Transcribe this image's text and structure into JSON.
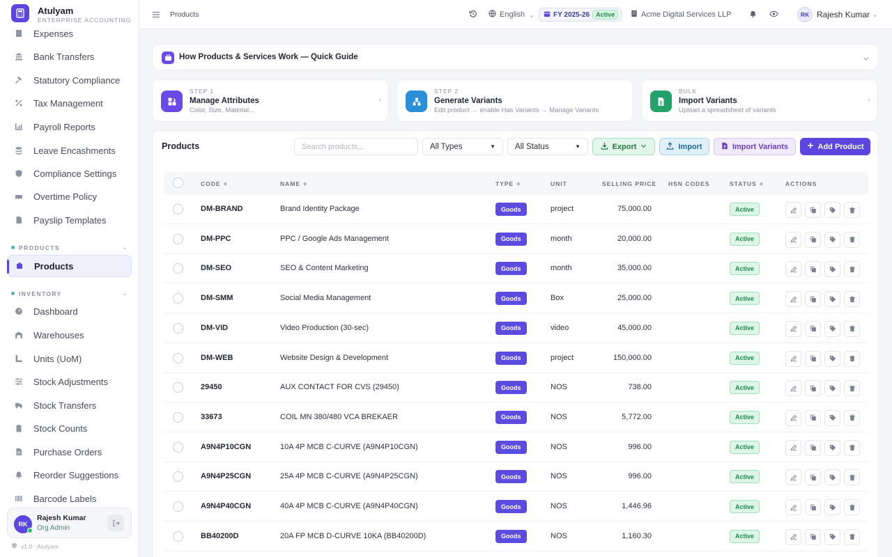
{
  "brand": {
    "name": "Atulyam",
    "subtitle": "ENTERPRISE ACCOUNTING"
  },
  "sidebar": {
    "items_top": [
      {
        "label": "Expenses",
        "icon": "receipt-icon"
      },
      {
        "label": "Bank Transfers",
        "icon": "bank-icon"
      },
      {
        "label": "Statutory Compliance",
        "icon": "gavel-icon"
      },
      {
        "label": "Tax Management",
        "icon": "percent-icon"
      },
      {
        "label": "Payroll Reports",
        "icon": "chart-icon"
      },
      {
        "label": "Leave Encashments",
        "icon": "coins-icon"
      },
      {
        "label": "Compliance Settings",
        "icon": "shield-icon"
      },
      {
        "label": "Overtime Policy",
        "icon": "clock-icon"
      },
      {
        "label": "Payslip Templates",
        "icon": "file-icon"
      }
    ],
    "section_products": "PRODUCTS",
    "products_item": "Products",
    "section_inventory": "INVENTORY",
    "items_inventory": [
      {
        "label": "Dashboard",
        "icon": "dashboard-icon"
      },
      {
        "label": "Warehouses",
        "icon": "warehouse-icon"
      },
      {
        "label": "Units (UoM)",
        "icon": "ruler-icon"
      },
      {
        "label": "Stock Adjustments",
        "icon": "sliders-icon"
      },
      {
        "label": "Stock Transfers",
        "icon": "truck-icon"
      },
      {
        "label": "Stock Counts",
        "icon": "clipboard-icon"
      },
      {
        "label": "Purchase Orders",
        "icon": "document-icon"
      },
      {
        "label": "Reorder Suggestions",
        "icon": "bell-icon"
      },
      {
        "label": "Barcode Labels",
        "icon": "barcode-icon"
      }
    ],
    "user": {
      "initials": "RK",
      "name": "Rajesh Kumar",
      "role": "Org Admin"
    },
    "version": "v1.0 · Atulyam"
  },
  "header": {
    "breadcrumb": "Products",
    "language": "English",
    "fy": "FY 2025-26",
    "fy_status": "Active",
    "company": "Acme Digital Services LLP",
    "user_initials": "RK",
    "user_name": "Rajesh Kumar"
  },
  "guide": {
    "title": "How Products & Services Work — Quick Guide"
  },
  "steps": [
    {
      "kicker": "STEP 1",
      "title": "Manage Attributes",
      "desc": "Color, Size, Material...",
      "color": "#6a4ae6",
      "icon": "attributes-icon"
    },
    {
      "kicker": "STEP 2",
      "title": "Generate Variants",
      "desc": "Edit product → enable Has Variants → Manage Variants",
      "color": "#2a8fd8",
      "icon": "variants-icon"
    },
    {
      "kicker": "BULK",
      "title": "Import Variants",
      "desc": "Upload a spreadsheet of variants",
      "color": "#24a06a",
      "icon": "spreadsheet-icon"
    }
  ],
  "products": {
    "title": "Products",
    "search_placeholder": "Search products...",
    "filter_type": "All Types",
    "filter_status": "All Status",
    "export_label": "Export",
    "import_label": "Import",
    "import_variants_label": "Import Variants",
    "add_label": "Add Product",
    "columns": {
      "code": "CODE",
      "name": "NAME",
      "type": "TYPE",
      "unit": "UNIT",
      "price": "SELLING PRICE",
      "hsn": "HSN CODES",
      "status": "STATUS",
      "actions": "ACTIONS"
    },
    "rows": [
      {
        "code": "DM-BRAND",
        "name": "Brand Identity Package",
        "type": "Goods",
        "unit": "project",
        "price": "75,000.00",
        "hsn": "",
        "status": "Active"
      },
      {
        "code": "DM-PPC",
        "name": "PPC / Google Ads Management",
        "type": "Goods",
        "unit": "month",
        "price": "20,000.00",
        "hsn": "",
        "status": "Active"
      },
      {
        "code": "DM-SEO",
        "name": "SEO & Content Marketing",
        "type": "Goods",
        "unit": "month",
        "price": "35,000.00",
        "hsn": "",
        "status": "Active"
      },
      {
        "code": "DM-SMM",
        "name": "Social Media Management",
        "type": "Goods",
        "unit": "Box",
        "price": "25,000.00",
        "hsn": "",
        "status": "Active"
      },
      {
        "code": "DM-VID",
        "name": "Video Production (30-sec)",
        "type": "Goods",
        "unit": "video",
        "price": "45,000.00",
        "hsn": "",
        "status": "Active"
      },
      {
        "code": "DM-WEB",
        "name": "Website Design & Development",
        "type": "Goods",
        "unit": "project",
        "price": "150,000.00",
        "hsn": "",
        "status": "Active"
      },
      {
        "code": "29450",
        "name": "AUX CONTACT FOR CVS (29450)",
        "type": "Goods",
        "unit": "NOS",
        "price": "738.00",
        "hsn": "",
        "status": "Active"
      },
      {
        "code": "33673",
        "name": "COIL MN 380/480 VCA BREKAER",
        "type": "Goods",
        "unit": "NOS",
        "price": "5,772.00",
        "hsn": "",
        "status": "Active"
      },
      {
        "code": "A9N4P10CGN",
        "name": "10A 4P MCB C-CURVE (A9N4P10CGN)",
        "type": "Goods",
        "unit": "NOS",
        "price": "996.00",
        "hsn": "",
        "status": "Active"
      },
      {
        "code": "A9N4P25CGN",
        "name": "25A 4P MCB C-CURVE (A9N4P25CGN)",
        "type": "Goods",
        "unit": "NOS",
        "price": "996.00",
        "hsn": "",
        "status": "Active"
      },
      {
        "code": "A9N4P40CGN",
        "name": "40A 4P MCB C-CURVE (A9N4P40CGN)",
        "type": "Goods",
        "unit": "NOS",
        "price": "1,446.96",
        "hsn": "",
        "status": "Active"
      },
      {
        "code": "BB40200D",
        "name": "20A FP MCB D-CURVE 10KA (BB40200D)",
        "type": "Goods",
        "unit": "NOS",
        "price": "1,160.30",
        "hsn": "",
        "status": "Active"
      }
    ]
  }
}
